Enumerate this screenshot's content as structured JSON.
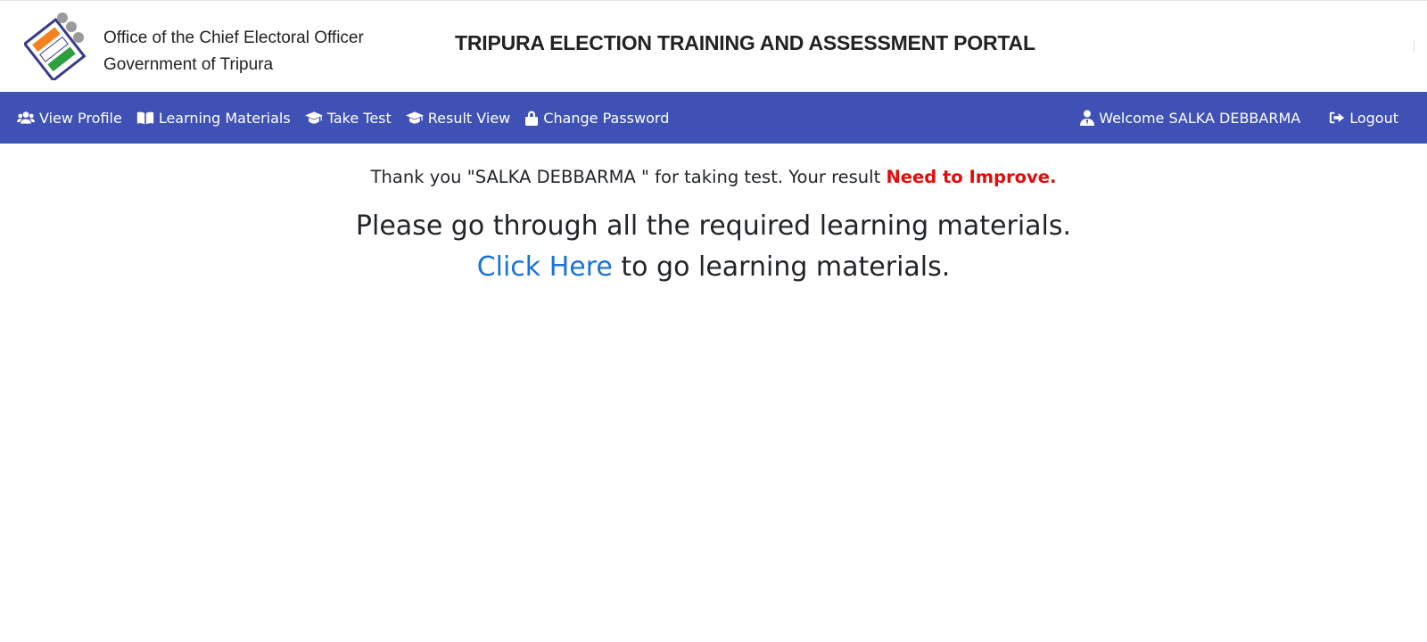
{
  "header": {
    "office_line1": "Office of the Chief Electoral Officer",
    "office_line2": "Government of Tripura",
    "portal_title": "TRIPURA ELECTION TRAINING AND ASSESSMENT PORTAL",
    "logo_icon": "election-commission-logo-icon"
  },
  "navbar": {
    "background": "#3f51b5",
    "items": [
      {
        "label": "View Profile",
        "icon": "users-icon"
      },
      {
        "label": "Learning Materials",
        "icon": "book-open-icon"
      },
      {
        "label": "Take Test",
        "icon": "graduation-cap-icon"
      },
      {
        "label": "Result View",
        "icon": "graduation-cap-icon"
      },
      {
        "label": "Change Password",
        "icon": "lock-icon"
      }
    ],
    "welcome": {
      "label": "Welcome SALKA DEBBARMA",
      "icon": "user-tie-icon"
    },
    "logout": {
      "label": "Logout",
      "icon": "sign-out-icon"
    }
  },
  "main": {
    "thanks_text": "Thank you \"SALKA DEBBARMA \" for taking test. Your result",
    "result_text": "Need to Improve.",
    "result_color": "#e30b0b",
    "advice_line1": "Please go through all the required learning materials.",
    "link_text": "Click Here",
    "link_color": "#1a73d9",
    "advice_line2_rest": "to go learning materials."
  }
}
